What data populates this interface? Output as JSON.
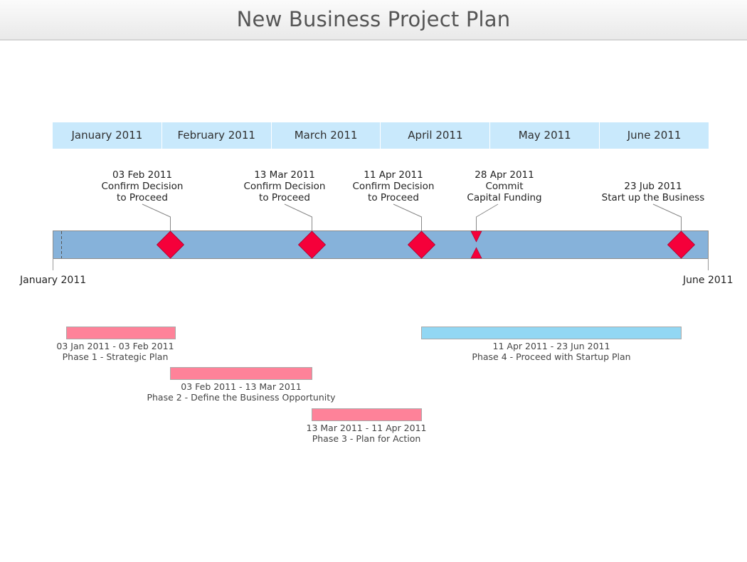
{
  "title": "New Business Project Plan",
  "months": [
    "January 2011",
    "February 2011",
    "March 2011",
    "April 2011",
    "May 2011",
    "June 2011"
  ],
  "axis": {
    "start_label": "January 2011",
    "end_label": "June 2011"
  },
  "colors": {
    "month_header": "#c9e9fc",
    "timeline_bar": "#86b2da",
    "milestone": "#f5003a",
    "phase_pink": "#fe8299",
    "phase_blue": "#92d7f3"
  },
  "milestones": [
    {
      "date": "03 Feb 2011",
      "line1": "Confirm Decision",
      "line2": "to Proceed",
      "shape": "diamond"
    },
    {
      "date": "13 Mar 2011",
      "line1": "Confirm Decision",
      "line2": "to Proceed",
      "shape": "diamond"
    },
    {
      "date": "11 Apr 2011",
      "line1": "Confirm Decision",
      "line2": "to Proceed",
      "shape": "diamond"
    },
    {
      "date": "28 Apr 2011",
      "line1": "Commit",
      "line2": "Capital Funding",
      "shape": "hourglass"
    },
    {
      "date": "23 Jub 2011",
      "line1": "Start up the Business",
      "line2": "",
      "shape": "diamond"
    }
  ],
  "phases": [
    {
      "range": "03 Jan 2011 - 03 Feb 2011",
      "name": "Phase 1 - Strategic Plan",
      "color": "pink"
    },
    {
      "range": "03 Feb 2011 - 13 Mar 2011",
      "name": "Phase 2 - Define the Business Opportunity",
      "color": "pink"
    },
    {
      "range": "13 Mar 2011 - 11 Apr 2011",
      "name": "Phase 3 - Plan for Action",
      "color": "pink"
    },
    {
      "range": "11 Apr 2011 - 23 Jun 2011",
      "name": "Phase 4 - Proceed with Startup Plan",
      "color": "blue"
    }
  ]
}
